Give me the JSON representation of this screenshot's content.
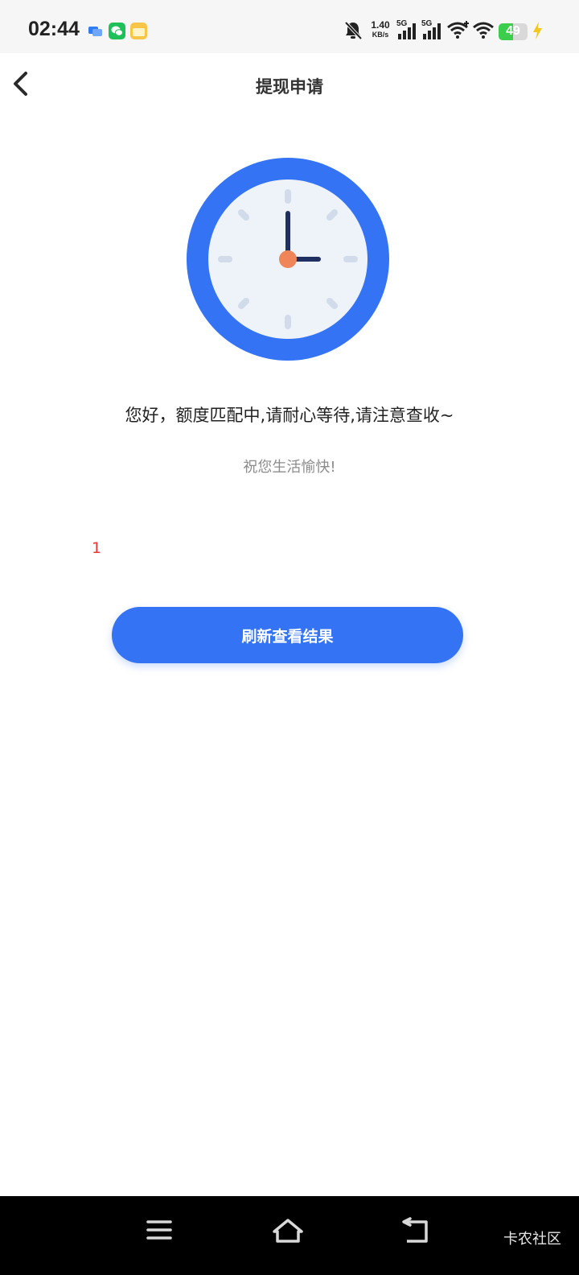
{
  "status_bar": {
    "time": "02:44",
    "speed_value": "1.40",
    "speed_unit": "KB/s",
    "signal_1_label": "5G",
    "signal_2_label": "5G",
    "battery_level": "49",
    "battery_fraction": 0.49,
    "icons": [
      "message-app-icon",
      "wechat-icon",
      "notes-app-icon",
      "mute-bell-icon",
      "signal-icon",
      "signal-icon",
      "wifi-plus-icon",
      "wifi-icon",
      "battery-icon",
      "charging-icon"
    ],
    "colors": {
      "wechat": "#1ec05a",
      "notes": "#f7c548",
      "message": "#2f7df6",
      "battery": "#3ccd4d",
      "charging": "#f3c624"
    }
  },
  "header": {
    "title": "提现申请",
    "back_icon": "chevron-left-icon"
  },
  "main": {
    "clock_icon": "clock-icon",
    "message": "您好，额度匹配中,请耐心等待,请注意查收~",
    "subtext": "祝您生活愉快!",
    "counter": "1",
    "refresh_button_label": "刷新查看结果",
    "colors": {
      "accent": "#3474f4",
      "counter": "#e8373a"
    }
  },
  "system_nav": {
    "icons": [
      "menu-icon",
      "home-icon",
      "back-icon"
    ],
    "watermark": "卡农社区"
  }
}
